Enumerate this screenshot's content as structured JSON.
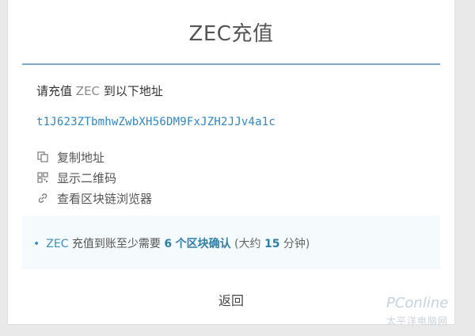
{
  "modal": {
    "title": "ZEC充值",
    "prompt_prefix": "请充值",
    "prompt_coin": "ZEC",
    "prompt_suffix": "到以下地址",
    "address": "t1J623ZTbmhwZwbXH56DM9FxJZH2JJv4a1c"
  },
  "actions": [
    {
      "label": "复制地址",
      "icon": "copy-icon"
    },
    {
      "label": "显示二维码",
      "icon": "qrcode-icon"
    },
    {
      "label": "查看区块链浏览器",
      "icon": "link-icon"
    }
  ],
  "notice": {
    "coin": "ZEC",
    "text_a": "充值到账至少需要",
    "confirm_count": "6",
    "confirm_text": "个区块确认",
    "approx": "(大约",
    "minutes": "15",
    "minutes_unit": "分钟)"
  },
  "footer": {
    "back_label": "返回"
  },
  "watermark": {
    "brand": "PConline",
    "sub": "太平洋电脑网"
  },
  "colors": {
    "accent": "#2c87c7",
    "rule": "#7fa6c4",
    "notice_bg": "#f5fafc"
  }
}
